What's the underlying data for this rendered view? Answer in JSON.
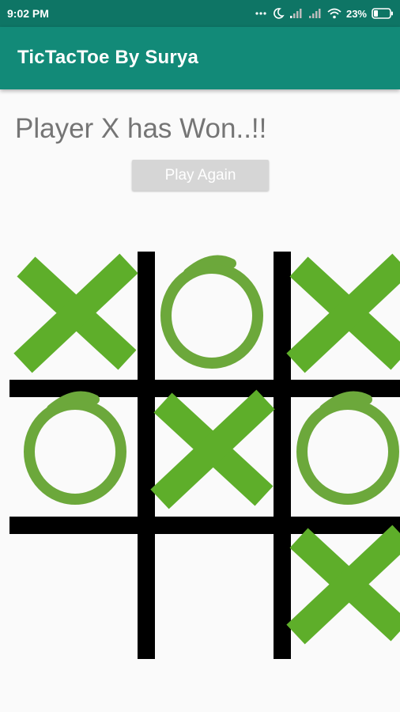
{
  "status_bar": {
    "time": "9:02 PM",
    "battery_percent": "23%",
    "icons": [
      "dots-icon",
      "moon-icon",
      "signal-icon",
      "signal-icon",
      "wifi-icon",
      "battery-icon"
    ]
  },
  "app_bar": {
    "title": "TicTacToe By Surya"
  },
  "game": {
    "message": "Player X has Won..!!",
    "play_again_label": "Play Again",
    "board": [
      "X",
      "O",
      "X",
      "O",
      "X",
      "O",
      "",
      "",
      "X"
    ]
  },
  "colors": {
    "status_bar": "#0e7565",
    "app_bar": "#128a78",
    "x_mark": "#5eae2a",
    "o_mark": "#6ca83b",
    "grid": "#000000",
    "button": "#d6d6d6",
    "message_text": "#757575"
  }
}
